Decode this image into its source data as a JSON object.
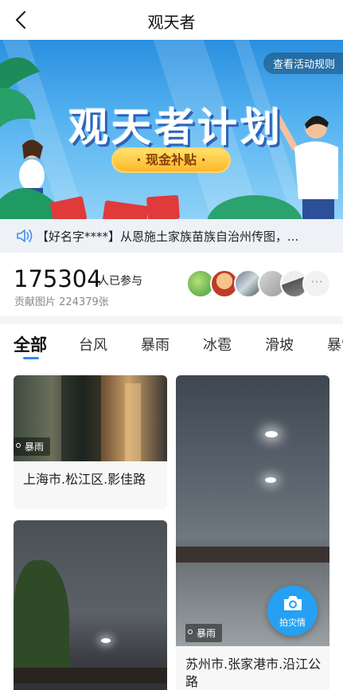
{
  "header": {
    "title": "观天者"
  },
  "banner": {
    "rules_button": "查看活动规则",
    "headline": "观天者计划",
    "pill": "· 现金补贴 ·"
  },
  "notice": {
    "text": "【好名字****】从恩施土家族苗族自治州传图，..."
  },
  "stats": {
    "participants": "175304",
    "participants_suffix": "人已参与",
    "contributions": "贡献图片 224379张",
    "more": "···"
  },
  "tabs": [
    {
      "label": "全部",
      "active": true
    },
    {
      "label": "台风"
    },
    {
      "label": "暴雨"
    },
    {
      "label": "冰雹"
    },
    {
      "label": "滑坡"
    },
    {
      "label": "暴雪"
    }
  ],
  "feed": {
    "cards": [
      {
        "tag": "暴雨",
        "location": "上海市.松江区.影佳路"
      },
      {
        "tag": "暴雨",
        "location": "苏州市.张家港市.沿江公路"
      },
      {
        "tag": "",
        "location": ""
      }
    ]
  },
  "fab": {
    "label": "拍灾情"
  },
  "colors": {
    "accent": "#2f8cf0",
    "fab": "#26a0f2",
    "banner_pill": "#ffc83d"
  }
}
